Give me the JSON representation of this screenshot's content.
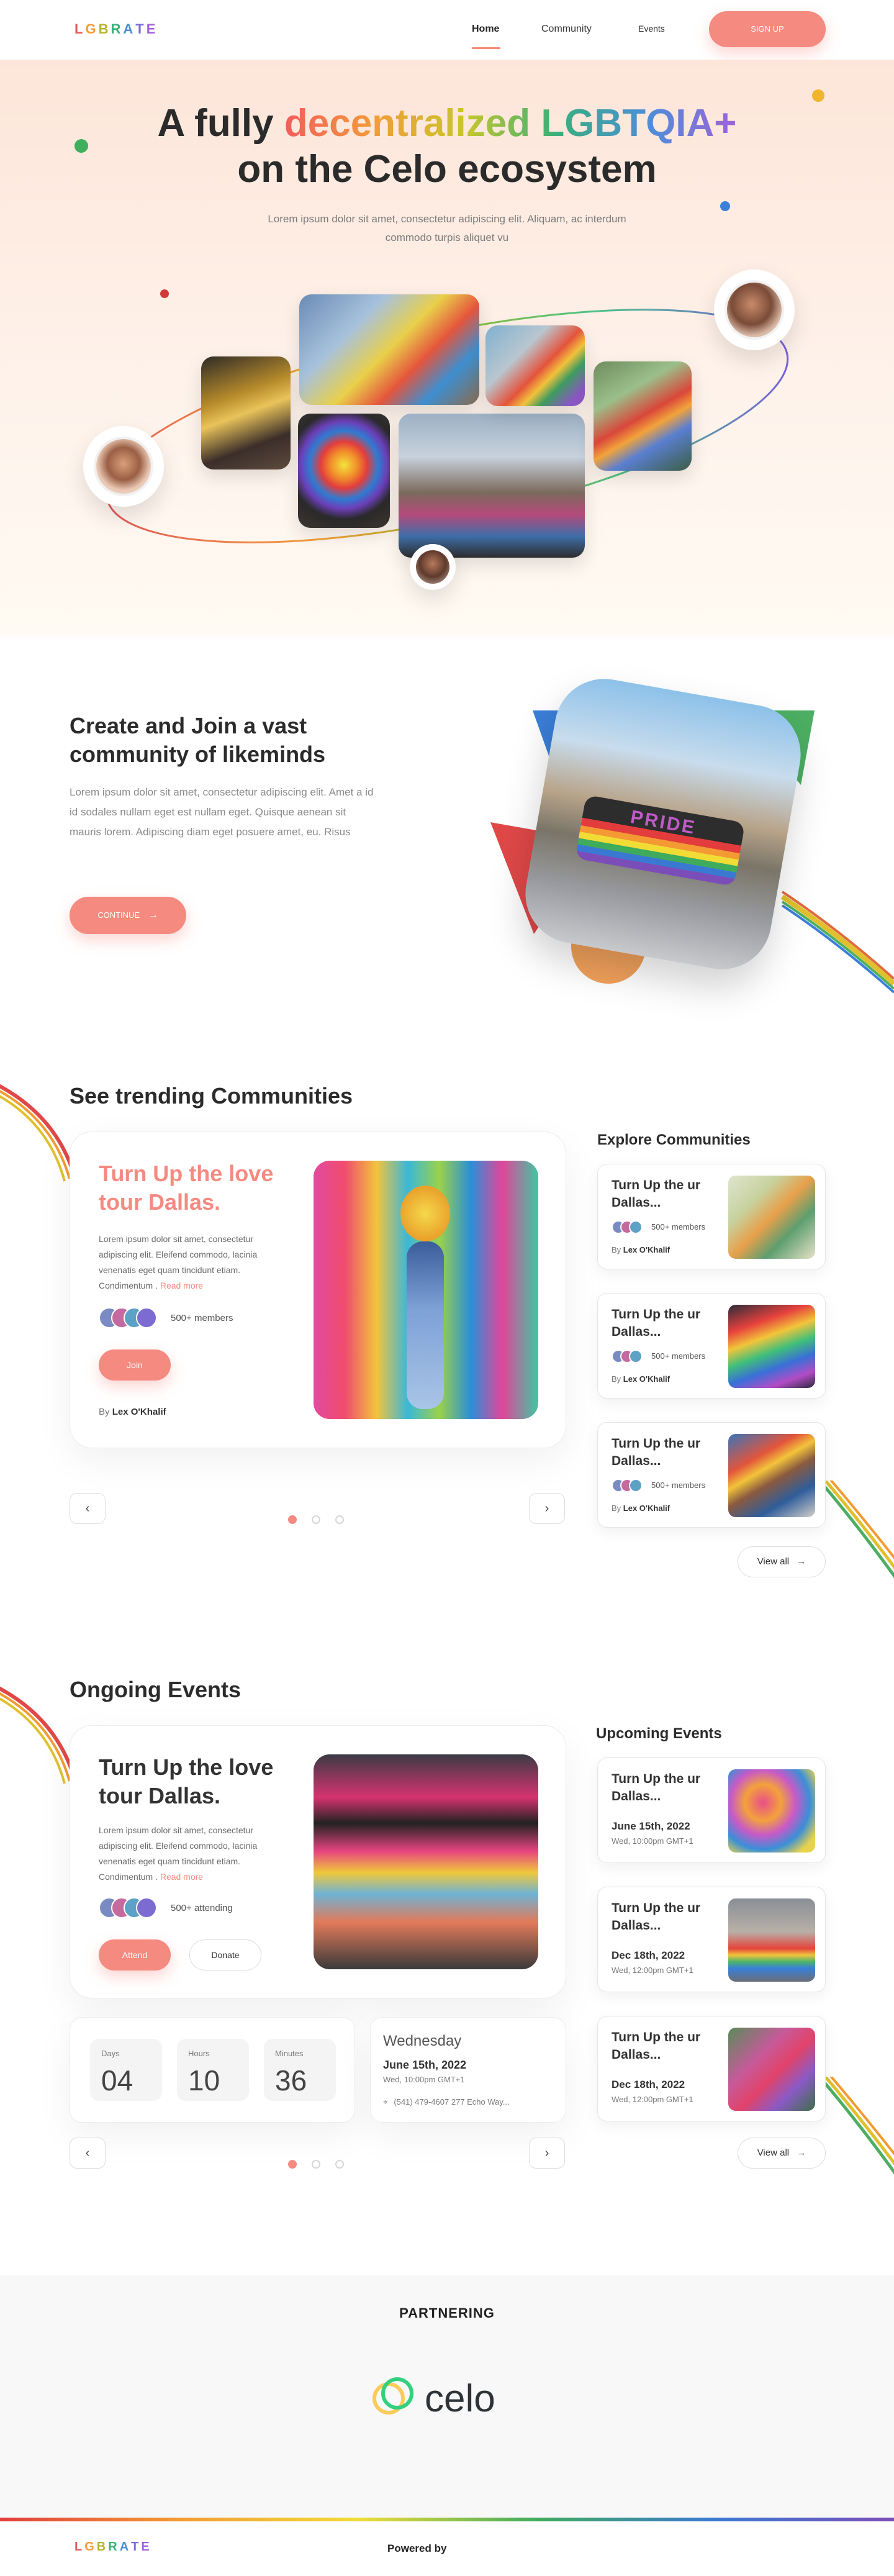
{
  "nav": {
    "logo": [
      "L",
      "G",
      "B",
      "R",
      "A",
      "T",
      "E"
    ],
    "links": [
      "Home",
      "Community",
      "Events"
    ],
    "signup": "SIGN UP"
  },
  "hero": {
    "title_line1_a": "A fully ",
    "title_line1_b": "decentralized LGBTQIA+",
    "title_line2": "on the Celo ecosystem",
    "subtitle": "Lorem ipsum dolor sit amet, consectetur adipiscing elit. Aliquam, ac interdum commodo turpis aliquet vu"
  },
  "community_intro": {
    "heading": "Create and Join a vast community of likeminds",
    "body": "Lorem ipsum dolor sit amet, consectetur adipiscing elit. Amet a id id sodales nullam eget est nullam eget. Quisque aenean sit mauris lorem. Adipiscing diam eget posuere amet, eu. Risus",
    "cta": "CONTINUE",
    "image_text": "PRIDE"
  },
  "trending": {
    "heading": "See trending Communities",
    "featured": {
      "title": "Turn Up the love tour Dallas.",
      "body": "Lorem ipsum dolor sit amet, consectetur adipiscing elit. Eleifend commodo, lacinia venenatis eget quam tincidunt etiam. Condimentum . ",
      "read_more": "Read more",
      "members": "500+ members",
      "join": "Join",
      "by_prefix": "By",
      "author": "Lex O'Khalif"
    },
    "explore_heading": "Explore Communities",
    "explore": [
      {
        "title": "Turn Up the ur Dallas...",
        "members": "500+ members",
        "by": "By",
        "author": "Lex O'Khalif"
      },
      {
        "title": "Turn Up the ur Dallas...",
        "members": "500+ members",
        "by": "By",
        "author": "Lex O'Khalif"
      },
      {
        "title": "Turn Up the ur Dallas...",
        "members": "500+ members",
        "by": "By",
        "author": "Lex O'Khalif"
      }
    ],
    "view_all": "View all"
  },
  "events": {
    "heading": "Ongoing Events",
    "featured": {
      "title": "Turn Up the love tour Dallas.",
      "body": "Lorem ipsum dolor sit amet, consectetur adipiscing elit. Eleifend commodo, lacinia venenatis eget quam tincidunt etiam. Condimentum . ",
      "read_more": "Read more",
      "attending": "500+ attending",
      "attend": "Attend",
      "donate": "Donate"
    },
    "countdown": [
      {
        "label": "Days",
        "value": "04"
      },
      {
        "label": "Hours",
        "value": "10"
      },
      {
        "label": "Minutes",
        "value": "36"
      }
    ],
    "date_card": {
      "day": "Wednesday",
      "date": "June 15th, 2022",
      "time": "Wed, 10:00pm GMT+1",
      "address": "(541) 479-4607 277 Echo Way..."
    },
    "upcoming_heading": "Upcoming Events",
    "upcoming": [
      {
        "title": "Turn Up the ur Dallas...",
        "date": "June 15th, 2022",
        "time": "Wed, 10:00pm GMT+1"
      },
      {
        "title": "Turn Up the ur Dallas...",
        "date": "Dec 18th, 2022",
        "time": "Wed, 12:00pm GMT+1"
      },
      {
        "title": "Turn Up the ur Dallas...",
        "date": "Dec 18th, 2022",
        "time": "Wed, 12:00pm GMT+1"
      }
    ],
    "view_all": "View all"
  },
  "partnering": {
    "heading": "PARTNERING",
    "partner": "celo"
  },
  "footer": {
    "logo": [
      "L",
      "G",
      "B",
      "R",
      "A",
      "T",
      "E"
    ],
    "powered_by": "Powered by"
  },
  "colors": {
    "accent": "#f58a80",
    "title_gradient": [
      "#f35d5d",
      "#f39c38",
      "#c7c72b",
      "#39b07a",
      "#4b8fd9",
      "#a062d8"
    ],
    "heading": "#2b2b2b"
  },
  "icons": [
    "arrow-right-icon",
    "chevron-left-icon",
    "chevron-right-icon",
    "location-icon"
  ]
}
